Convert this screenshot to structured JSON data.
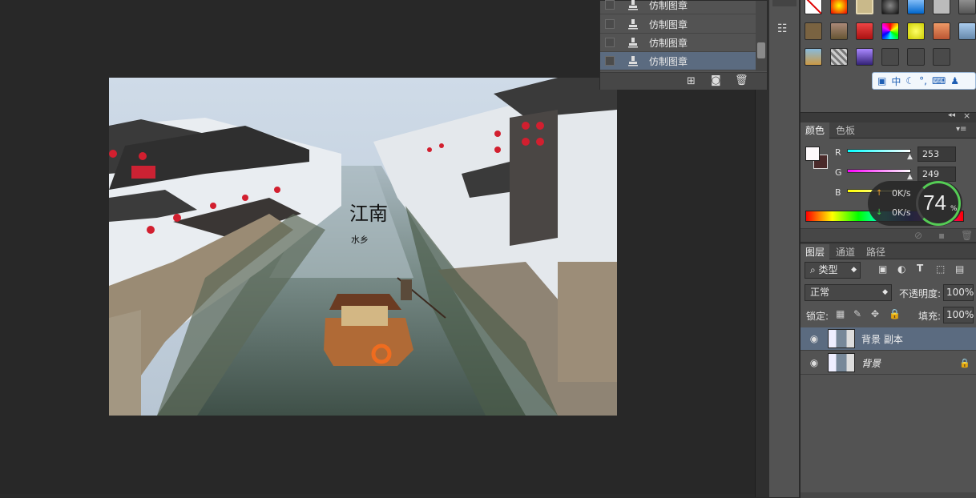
{
  "history": {
    "items": [
      {
        "label": "仿制图章",
        "selected": false
      },
      {
        "label": "仿制图章",
        "selected": false
      },
      {
        "label": "仿制图章",
        "selected": false
      },
      {
        "label": "仿制图章",
        "selected": true
      }
    ]
  },
  "photo": {
    "calligraphy_main": "江南",
    "calligraphy_sub": "水乡"
  },
  "ime": {
    "mode": "中"
  },
  "color_panel": {
    "tabs": [
      "颜色",
      "色板"
    ],
    "r_label": "R",
    "g_label": "G",
    "b_label": "B",
    "r_value": "253",
    "g_value": "249",
    "foreground": "#fdf9fb",
    "background": "#4a2a2a"
  },
  "speed_widget": {
    "percent": "74",
    "percent_unit": "%",
    "upload": "0K/s",
    "download": "0K/s"
  },
  "layers_panel": {
    "tabs": [
      "图层",
      "通道",
      "路径"
    ],
    "filter_label": "类型",
    "blend_mode": "正常",
    "opacity_label": "不透明度:",
    "opacity_value": "100%",
    "lock_label": "锁定:",
    "fill_label": "填充:",
    "fill_value": "100%",
    "layers": [
      {
        "name": "背景 副本",
        "selected": true,
        "locked": false
      },
      {
        "name": "背景",
        "selected": false,
        "locked": true
      }
    ]
  },
  "colors": {
    "accent_selected": "#5b6b80",
    "panel_bg": "#535353",
    "canvas_bg": "#282828"
  }
}
